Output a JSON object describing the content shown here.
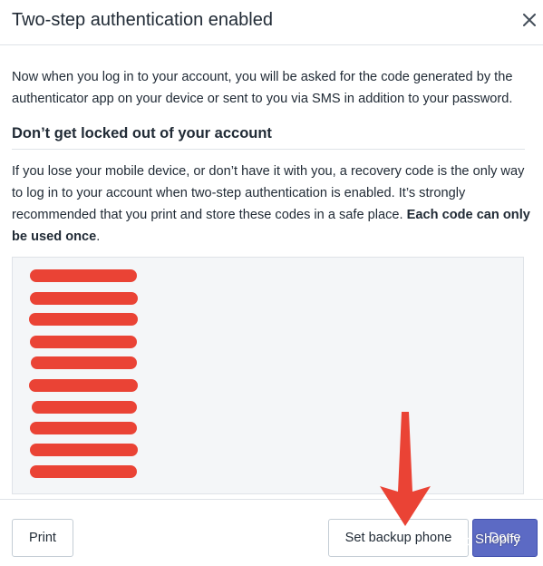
{
  "dialog": {
    "title": "Two-step authentication enabled",
    "intro": "Now when you log in to your account, you will be asked for the code generated by the authenticator app on your device or sent to you via SMS in addition to your password.",
    "section_title": "Don’t get locked out of your account",
    "warning_text": "If you lose your mobile device, or don’t have it with you, a recovery code is the only way to log in to your account when two-step authentication is enabled. It’s strongly recommended that you print and store these codes in a safe place. ",
    "warning_emphasis": "Each code can only be used once",
    "warning_end": "."
  },
  "recovery_codes": {
    "redacted_count": 10
  },
  "footer": {
    "print_label": "Print",
    "backup_label": "Set backup phone",
    "done_label": "Done"
  },
  "annotation": {
    "arrow_color": "#ea4335"
  },
  "watermark": {
    "text": "Shopify"
  },
  "colors": {
    "primary": "#5c6ac4",
    "border": "#dfe3e8",
    "redaction": "#ea4335"
  }
}
